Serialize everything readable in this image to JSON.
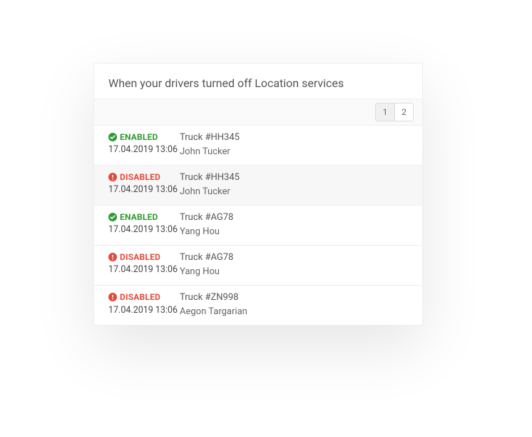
{
  "title": "When your drivers turned off Location services",
  "pagination": {
    "pages": [
      "1",
      "2"
    ],
    "active": 0
  },
  "status_labels": {
    "enabled": "ENABLED",
    "disabled": "DISABLED"
  },
  "icons": {
    "enabled": "check-circle-icon",
    "disabled": "alert-circle-icon"
  },
  "colors": {
    "enabled": "#2e9b2e",
    "disabled": "#e24a3b"
  },
  "rows": [
    {
      "status": "enabled",
      "timestamp": "17.04.2019 13:06",
      "vehicle": "Truck #HH345",
      "driver": "John Tucker",
      "alt": false
    },
    {
      "status": "disabled",
      "timestamp": "17.04.2019 13:06",
      "vehicle": "Truck #HH345",
      "driver": "John Tucker",
      "alt": true
    },
    {
      "status": "enabled",
      "timestamp": "17.04.2019 13:06",
      "vehicle": "Truck #AG78",
      "driver": "Yang Hou",
      "alt": false
    },
    {
      "status": "disabled",
      "timestamp": "17.04.2019 13:06",
      "vehicle": "Truck #AG78",
      "driver": "Yang Hou",
      "alt": false
    },
    {
      "status": "disabled",
      "timestamp": "17.04.2019 13:06",
      "vehicle": "Truck #ZN998",
      "driver": "Aegon Targarian",
      "alt": false
    }
  ]
}
